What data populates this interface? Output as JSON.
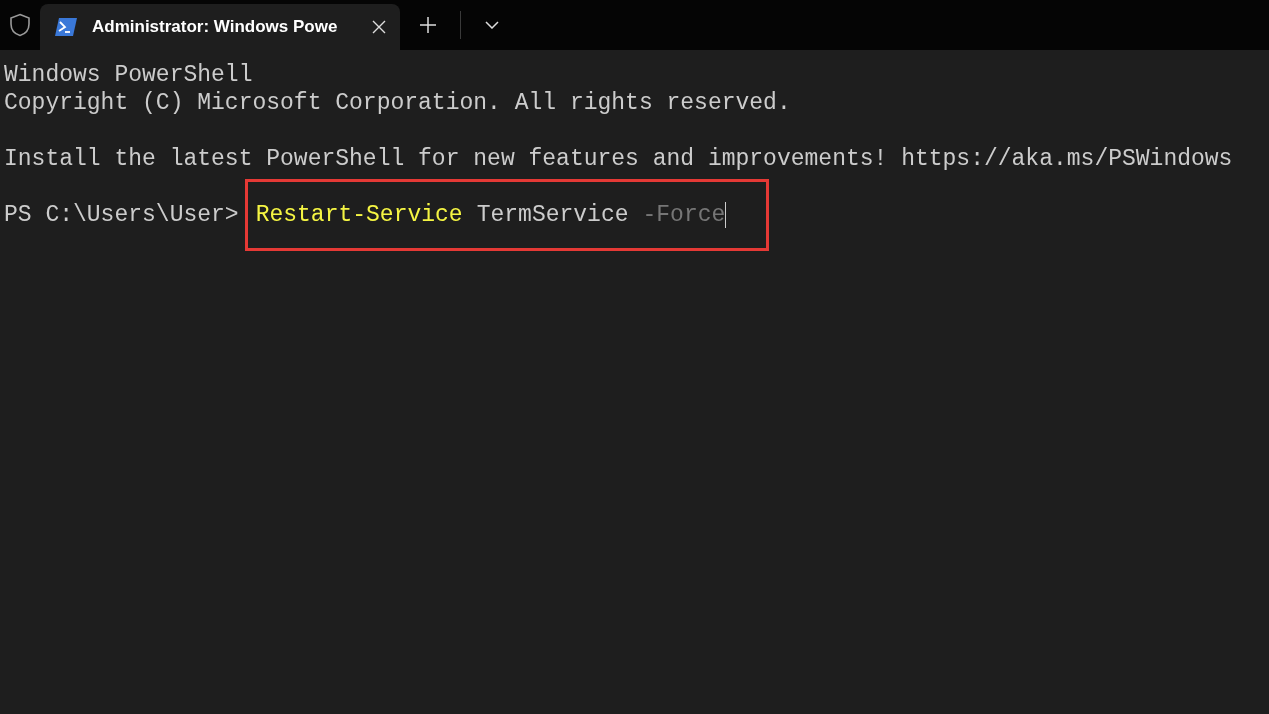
{
  "tabs": [
    {
      "title": "Administrator: Windows Powe",
      "selected": true
    }
  ],
  "output_blocks": [
    [
      "Windows PowerShell",
      "Copyright (C) Microsoft Corporation. All rights reserved."
    ],
    [
      "Install the latest PowerShell for new features and improvements! https://aka.ms/PSWindows"
    ]
  ],
  "prompt": {
    "text": "PS C:\\Users\\User>",
    "highlighted": true,
    "tokens": [
      {
        "text": "Restart-Service",
        "kind": "command"
      },
      {
        "text": "TermService",
        "kind": "argument"
      },
      {
        "text": "-Force",
        "kind": "suggestion"
      }
    ]
  }
}
